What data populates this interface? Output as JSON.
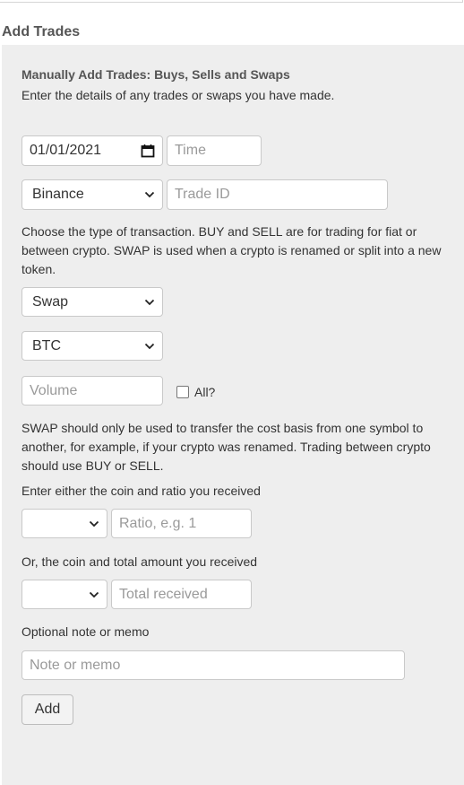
{
  "page": {
    "title": "Add Trades"
  },
  "panel": {
    "heading": "Manually Add Trades: Buys, Sells and Swaps",
    "intro": "Enter the details of any trades or swaps you have made.",
    "date_value": "01/01/2021",
    "time_placeholder": "Time",
    "exchange_value": "Binance",
    "trade_id_placeholder": "Trade ID",
    "type_help": "Choose the type of transaction. BUY and SELL are for trading for fiat or between crypto. SWAP is used when a crypto is renamed or split into a new token.",
    "type_value": "Swap",
    "coin_value": "BTC",
    "volume_placeholder": "Volume",
    "all_label": "All?",
    "all_checked": false,
    "swap_help": "SWAP should only be used to transfer the cost basis from one symbol to another, for example, if your crypto was renamed. Trading between crypto should use BUY or SELL.",
    "ratio_prompt": "Enter either the coin and ratio you received",
    "ratio_coin_value": "",
    "ratio_placeholder": "Ratio, e.g. 1",
    "total_prompt": "Or, the coin and total amount you received",
    "total_coin_value": "",
    "total_placeholder": "Total received",
    "note_label": "Optional note or memo",
    "note_placeholder": "Note or memo",
    "add_button": "Add"
  },
  "icons": {
    "calendar": "calendar-icon",
    "chevron": "chevron-down-icon"
  },
  "colors": {
    "panel_bg": "#eeeeee",
    "placeholder": "#9a9a9a",
    "text": "#333333"
  }
}
